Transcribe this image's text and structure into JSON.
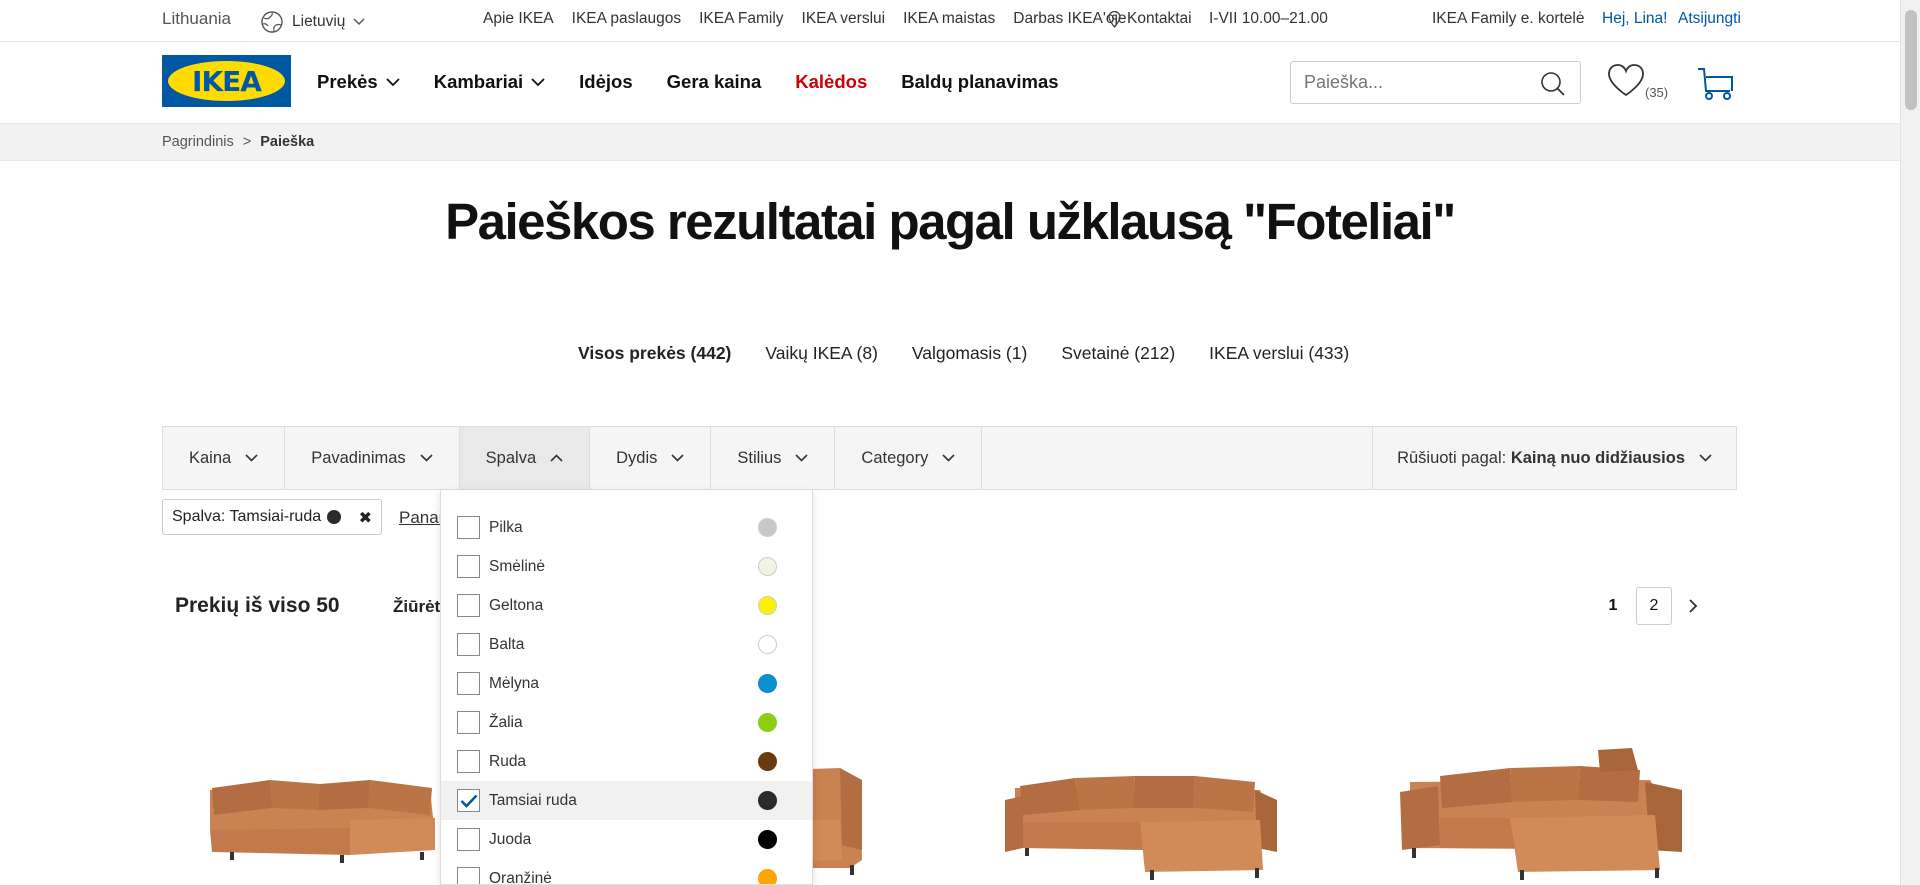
{
  "topbar": {
    "country": "Lithuania",
    "language": "Lietuvių",
    "links": [
      "Apie IKEA",
      "IKEA paslaugos",
      "IKEA Family",
      "IKEA verslui",
      "IKEA maistas",
      "Darbas IKEA'oje"
    ],
    "contact": "Kontaktai",
    "hours": "I-VII 10.00–21.00",
    "family_card": "IKEA Family e. kortelė",
    "greeting": "Hej, Lina!",
    "logout": "Atsijungti"
  },
  "header": {
    "logo_text": "IKEA",
    "nav": [
      {
        "label": "Prekės",
        "dropdown": true
      },
      {
        "label": "Kambariai",
        "dropdown": true
      },
      {
        "label": "Idėjos",
        "dropdown": false
      },
      {
        "label": "Gera kaina",
        "dropdown": false
      },
      {
        "label": "Kalėdos",
        "dropdown": false,
        "highlight": "#cc0008"
      },
      {
        "label": "Baldų planavimas",
        "dropdown": false
      }
    ],
    "search_placeholder": "Paieška...",
    "wishlist_count": "(35)"
  },
  "breadcrumb": {
    "home": "Pagrindinis",
    "separator": ">",
    "current": "Paieška"
  },
  "page_title": "Paieškos rezultatai pagal užklausą \"Foteliai\"",
  "categories": [
    {
      "label": "Visos prekės (442)",
      "active": true
    },
    {
      "label": "Vaikų IKEA (8)",
      "active": false
    },
    {
      "label": "Valgomasis (1)",
      "active": false
    },
    {
      "label": "Svetainė (212)",
      "active": false
    },
    {
      "label": "IKEA verslui (433)",
      "active": false
    }
  ],
  "filters": [
    {
      "label": "Kaina",
      "open": false
    },
    {
      "label": "Pavadinimas",
      "open": false
    },
    {
      "label": "Spalva",
      "open": true
    },
    {
      "label": "Dydis",
      "open": false
    },
    {
      "label": "Stilius",
      "open": false
    },
    {
      "label": "Category",
      "open": false
    }
  ],
  "sort": {
    "label": "Rūšiuoti pagal:",
    "value": "Kainą nuo didžiausios"
  },
  "active_filter": {
    "label": "Spalva: Tamsiai-ruda",
    "color": "#2b2b2b"
  },
  "clear_link": "Panaikinti",
  "results": {
    "total": "Prekių iš viso 50",
    "view_label": "Žiūrėti"
  },
  "pagination": {
    "current": "1",
    "next_page": "2"
  },
  "color_options": [
    {
      "label": "Pilka",
      "color": "#c8c8c8",
      "checked": false
    },
    {
      "label": "Smėlinė",
      "color": "#f2f3e0",
      "checked": false
    },
    {
      "label": "Geltona",
      "color": "#fff200",
      "checked": false
    },
    {
      "label": "Balta",
      "color": "#ffffff",
      "checked": false
    },
    {
      "label": "Mėlyna",
      "color": "#0a8fcf",
      "checked": false
    },
    {
      "label": "Žalia",
      "color": "#8fcc14",
      "checked": false
    },
    {
      "label": "Ruda",
      "color": "#6b3a10",
      "checked": false
    },
    {
      "label": "Tamsiai ruda",
      "color": "#2b2b2b",
      "checked": true
    },
    {
      "label": "Juoda",
      "color": "#000000",
      "checked": false
    },
    {
      "label": "Oranžinė",
      "color": "#ffa500",
      "checked": false
    }
  ],
  "colors": {
    "brand_blue": "#0058a3",
    "brand_yellow": "#ffdb00",
    "sofa": "#c98252",
    "sofa_dark": "#a9653a"
  }
}
